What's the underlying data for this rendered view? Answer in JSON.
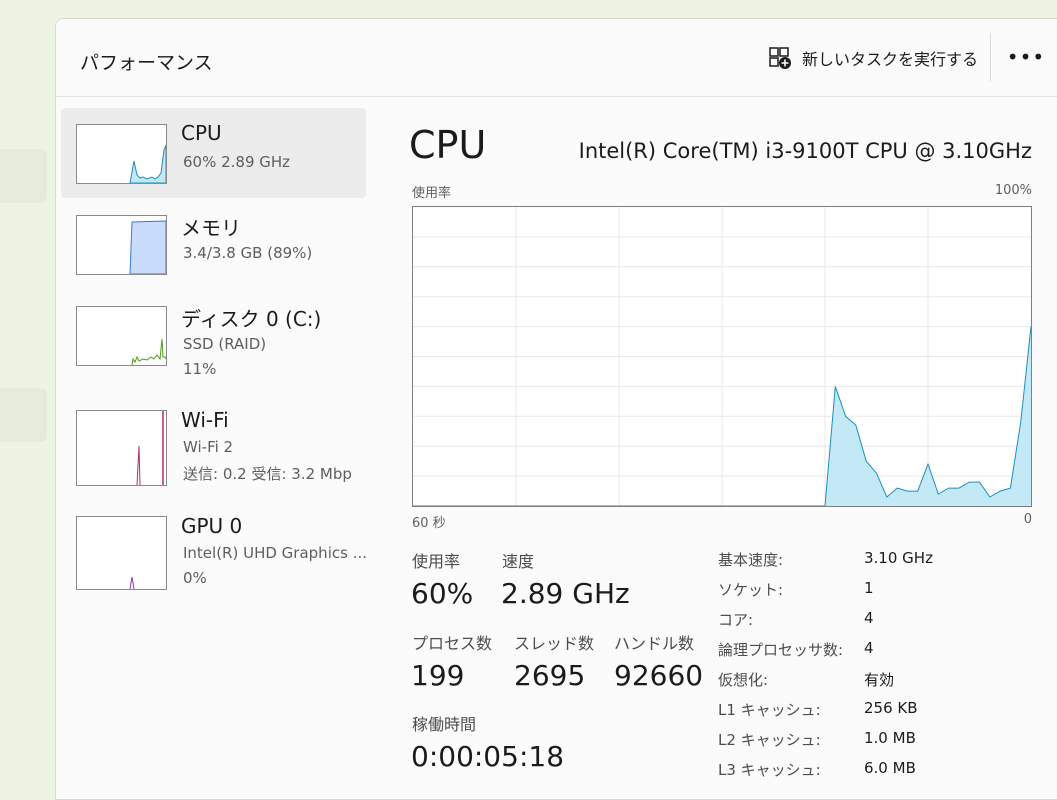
{
  "header": {
    "title": "パフォーマンス",
    "new_task_label": "新しいタスクを実行する",
    "more_label": "•••"
  },
  "sidebar": {
    "items": [
      {
        "name": "CPU",
        "sub1": "60%  2.89 GHz",
        "sub2": "",
        "color": "#1c8fc0"
      },
      {
        "name": "メモリ",
        "sub1": "3.4/3.8 GB (89%)",
        "sub2": "",
        "color": "#3c78d8"
      },
      {
        "name": "ディスク 0 (C:)",
        "sub1": "SSD (RAID)",
        "sub2": "11%",
        "color": "#4d9a1e"
      },
      {
        "name": "Wi-Fi",
        "sub1": "Wi-Fi 2",
        "sub2": "送信: 0.2  受信: 3.2 Mbp",
        "color": "#b22e6a"
      },
      {
        "name": "GPU 0",
        "sub1": "Intel(R) UHD Graphics ...",
        "sub2": "0%",
        "color": "#8a3cc4"
      }
    ]
  },
  "main": {
    "title": "CPU",
    "model": "Intel(R) Core(TM) i3-9100T CPU @ 3.10GHz",
    "graph": {
      "y_label": "使用率",
      "y_max_label": "100%",
      "x_left_label": "60 秒",
      "x_right_label": "0"
    },
    "stats": {
      "utilization_label": "使用率",
      "utilization_value": "60%",
      "speed_label": "速度",
      "speed_value": "2.89 GHz",
      "processes_label": "プロセス数",
      "processes_value": "199",
      "threads_label": "スレッド数",
      "threads_value": "2695",
      "handles_label": "ハンドル数",
      "handles_value": "92660",
      "uptime_label": "稼働時間",
      "uptime_value": "0:00:05:18"
    },
    "specs": [
      {
        "label": "基本速度:",
        "value": "3.10 GHz"
      },
      {
        "label": "ソケット:",
        "value": "1"
      },
      {
        "label": "コア:",
        "value": "4"
      },
      {
        "label": "論理プロセッサ数:",
        "value": "4"
      },
      {
        "label": "仮想化:",
        "value": "有効"
      },
      {
        "label": "L1 キャッシュ:",
        "value": "256 KB"
      },
      {
        "label": "L2 キャッシュ:",
        "value": "1.0 MB"
      },
      {
        "label": "L3 キャッシュ:",
        "value": "6.0 MB"
      }
    ]
  },
  "chart_data": {
    "type": "area",
    "title": "",
    "xlabel": "",
    "ylabel": "使用率",
    "xlim": [
      60,
      0
    ],
    "ylim": [
      0,
      100
    ],
    "x": [
      60,
      59,
      58,
      57,
      56,
      55,
      54,
      53,
      52,
      51,
      50,
      49,
      48,
      47,
      46,
      45,
      44,
      43,
      42,
      41,
      40,
      39,
      38,
      37,
      36,
      35,
      34,
      33,
      32,
      31,
      30,
      29,
      28,
      27,
      26,
      25,
      24,
      23,
      22,
      21,
      20,
      19,
      18,
      17,
      16,
      15,
      14,
      13,
      12,
      11,
      10,
      9,
      8,
      7,
      6,
      5,
      4,
      3,
      2,
      1,
      0
    ],
    "values": [
      0,
      0,
      0,
      0,
      0,
      0,
      0,
      0,
      0,
      0,
      0,
      0,
      0,
      0,
      0,
      0,
      0,
      0,
      0,
      0,
      0,
      0,
      0,
      0,
      0,
      0,
      0,
      0,
      0,
      0,
      0,
      0,
      0,
      0,
      0,
      0,
      0,
      0,
      0,
      0,
      0,
      40,
      30,
      27,
      15,
      11,
      3,
      6,
      5,
      5,
      14,
      4,
      6,
      6,
      8,
      8,
      3,
      5,
      6,
      28,
      60
    ],
    "color": "#1c8fc0",
    "fill": "#c3e9f7",
    "grid": true
  }
}
